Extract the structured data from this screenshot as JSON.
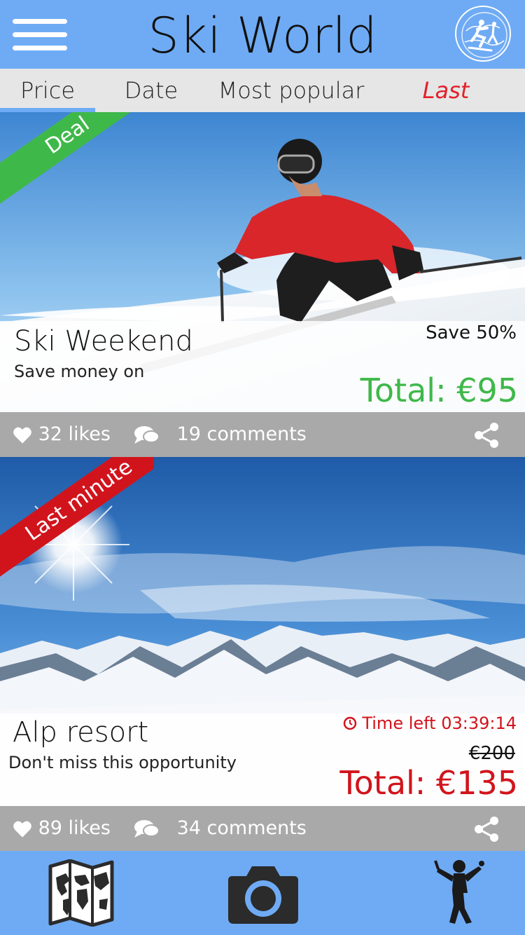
{
  "app": {
    "title": "Ski World"
  },
  "tabs": [
    {
      "label": "Price",
      "active": true
    },
    {
      "label": "Date",
      "active": false
    },
    {
      "label": "Most popular",
      "active": false
    },
    {
      "label": "Last minute",
      "active": false
    }
  ],
  "cards": [
    {
      "ribbon": "Deal",
      "ribbon_color": "#3fb84a",
      "title": "Ski Weekend",
      "subtitle": "Save money on",
      "badge": "Save 50%",
      "total": "Total: €95",
      "total_color": "#3fb84a",
      "likes": "32 likes",
      "comments": "19 comments"
    },
    {
      "ribbon": "Last minute",
      "ribbon_color": "#d1141c",
      "title": "Alp resort",
      "subtitle": "Don't miss this opportunity",
      "badge": "Time left 03:39:14",
      "old_price": "€200",
      "total": "Total: €135",
      "total_color": "#d1141c",
      "likes": "89 likes",
      "comments": "34 comments"
    }
  ],
  "colors": {
    "accent": "#6fabf4",
    "tab_bg": "#e6e6e6",
    "action_bar": "#a9a9a9",
    "deal": "#3fb84a",
    "last_minute": "#e3202a"
  },
  "bottom_nav": [
    "map-icon",
    "camera-icon",
    "golfer-icon"
  ]
}
